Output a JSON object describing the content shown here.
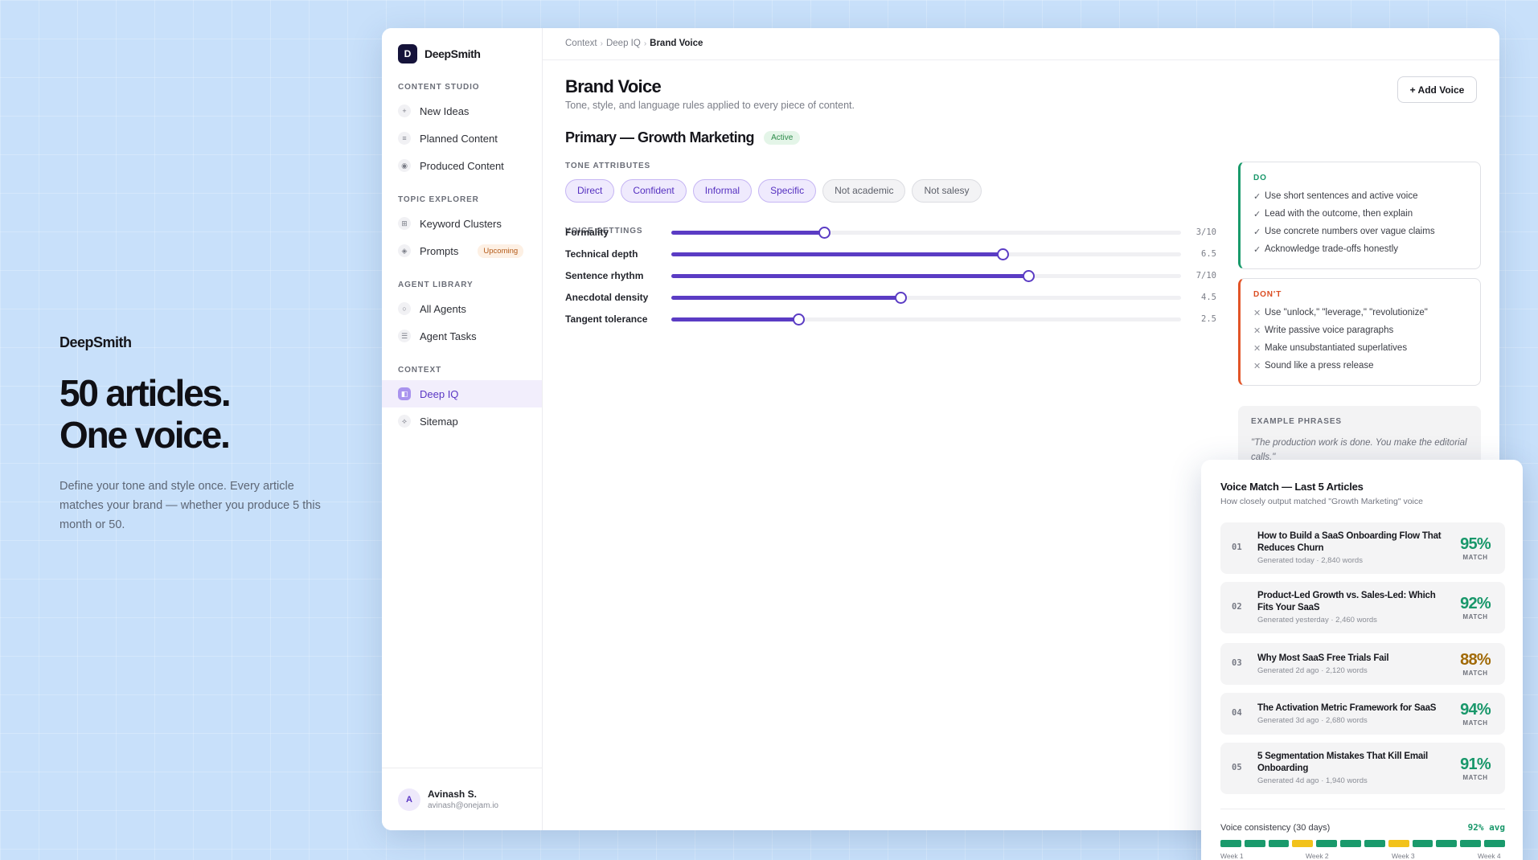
{
  "hero": {
    "brand": "DeepSmith",
    "headline_line1": "50 articles.",
    "headline_line2": "One voice.",
    "body": "Define your tone and style once. Every article matches your brand — whether you produce 5 this month or 50."
  },
  "sidebar": {
    "logo_letter": "D",
    "brand": "DeepSmith",
    "sections": [
      {
        "heading": "CONTENT STUDIO",
        "items": [
          {
            "label": "New Ideas",
            "icon": "+"
          },
          {
            "label": "Planned Content",
            "icon": "≡"
          },
          {
            "label": "Produced Content",
            "icon": "◉"
          }
        ]
      },
      {
        "heading": "TOPIC EXPLORER",
        "items": [
          {
            "label": "Keyword Clusters",
            "icon": "⊞"
          },
          {
            "label": "Prompts",
            "icon": "◈",
            "badge": "Upcoming"
          }
        ]
      },
      {
        "heading": "AGENT LIBRARY",
        "items": [
          {
            "label": "All Agents",
            "icon": "○"
          },
          {
            "label": "Agent Tasks",
            "icon": "☰"
          }
        ]
      },
      {
        "heading": "CONTEXT",
        "items": [
          {
            "label": "Deep IQ",
            "icon": "◧",
            "active": true
          },
          {
            "label": "Sitemap",
            "icon": "⟡"
          }
        ]
      }
    ],
    "user": {
      "initial": "A",
      "name": "Avinash S.",
      "email": "avinash@onejam.io"
    }
  },
  "breadcrumb": {
    "items": [
      "Context",
      "Deep IQ",
      "Brand Voice"
    ],
    "separator": "›"
  },
  "page": {
    "title": "Brand Voice",
    "subtitle": "Tone, style, and language rules applied to every piece of content.",
    "add_button": "+ Add Voice"
  },
  "voice": {
    "name": "Primary — Growth Marketing",
    "status": "Active",
    "tone_heading": "TONE ATTRIBUTES",
    "tones": [
      {
        "label": "Direct",
        "selected": true
      },
      {
        "label": "Confident",
        "selected": true
      },
      {
        "label": "Informal",
        "selected": true
      },
      {
        "label": "Specific",
        "selected": true
      },
      {
        "label": "Not academic",
        "selected": false
      },
      {
        "label": "Not salesy",
        "selected": false
      }
    ],
    "settings_heading": "VOICE SETTINGS",
    "settings": [
      {
        "label": "Formality",
        "value": 3,
        "display": "3/10"
      },
      {
        "label": "Technical depth",
        "value": 6.5,
        "display": "6.5"
      },
      {
        "label": "Sentence rhythm",
        "value": 7,
        "display": "7/10"
      },
      {
        "label": "Anecdotal density",
        "value": 4.5,
        "display": "4.5"
      },
      {
        "label": "Tangent tolerance",
        "value": 2.5,
        "display": "2.5"
      }
    ],
    "scale_max": 10
  },
  "rules": {
    "do": {
      "title": "DO",
      "mark": "✓",
      "items": [
        "Use short sentences and active voice",
        "Lead with the outcome, then explain",
        "Use concrete numbers over vague claims",
        "Acknowledge trade-offs honestly"
      ]
    },
    "dont": {
      "title": "DON'T",
      "mark": "✕",
      "items": [
        "Use \"unlock,\" \"leverage,\" \"revolutionize\"",
        "Write passive voice paragraphs",
        "Make unsubstantiated superlatives",
        "Sound like a press release"
      ]
    }
  },
  "examples": {
    "title": "EXAMPLE PHRASES",
    "text": "\"The production work is done. You make the editorial calls.\""
  },
  "voice_match": {
    "title": "Voice Match — Last 5 Articles",
    "subtitle": "How closely output matched \"Growth Marketing\" voice",
    "match_label": "MATCH",
    "articles": [
      {
        "num": "01",
        "title": "How to Build a SaaS Onboarding Flow That Reduces Churn",
        "meta": "Generated today · 2,840 words",
        "score": "95%",
        "color": "#18976a"
      },
      {
        "num": "02",
        "title": "Product-Led Growth vs. Sales-Led: Which Fits Your SaaS",
        "meta": "Generated yesterday · 2,460 words",
        "score": "92%",
        "color": "#18976a"
      },
      {
        "num": "03",
        "title": "Why Most SaaS Free Trials Fail",
        "meta": "Generated 2d ago · 2,120 words",
        "score": "88%",
        "color": "#a16a07"
      },
      {
        "num": "04",
        "title": "The Activation Metric Framework for SaaS",
        "meta": "Generated 3d ago · 2,680 words",
        "score": "94%",
        "color": "#18976a"
      },
      {
        "num": "05",
        "title": "5 Segmentation Mistakes That Kill Email Onboarding",
        "meta": "Generated 4d ago · 1,940 words",
        "score": "91%",
        "color": "#18976a"
      }
    ],
    "consistency_label": "Voice consistency (30 days)",
    "consistency_avg": "92% avg",
    "segments": [
      "good",
      "good",
      "good",
      "warn",
      "good",
      "good",
      "good",
      "warn",
      "good",
      "good",
      "good",
      "good"
    ],
    "segment_colors": {
      "good": "#1a9a6c",
      "warn": "#f2c21b"
    },
    "weeks": [
      "Week 1",
      "Week 2",
      "Week 3",
      "Week 4"
    ]
  }
}
